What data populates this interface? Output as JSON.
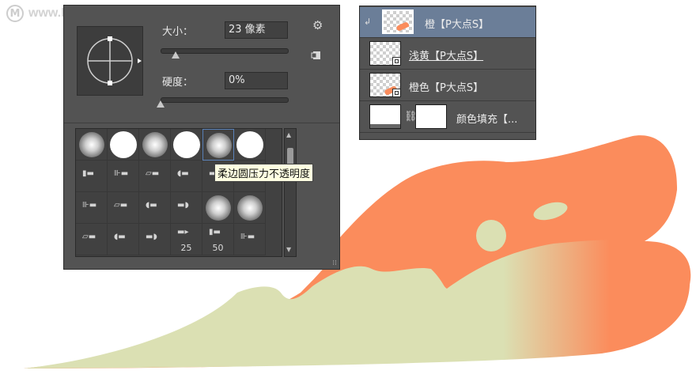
{
  "watermark": {
    "logo_letter": "M",
    "text": "www.MacDown.com"
  },
  "brush_panel": {
    "size_label": "大小：",
    "size_value": "23 像素",
    "size_level": 0.12,
    "hardness_label": "硬度：",
    "hardness_value": "0%",
    "hardness_level": 0.0,
    "settings_icon": "gear-icon",
    "new_preset_icon": "new-preset-icon",
    "preset_grid": [
      [
        {
          "kind": "soft"
        },
        {
          "kind": "hard"
        },
        {
          "kind": "soft"
        },
        {
          "kind": "hard"
        },
        {
          "kind": "soft",
          "selected": true
        },
        {
          "kind": "hard"
        }
      ],
      [
        {
          "kind": "tip"
        },
        {
          "kind": "tip"
        },
        {
          "kind": "tip"
        },
        {
          "kind": "tip"
        },
        {
          "kind": "tip"
        },
        {
          "kind": "tip"
        }
      ],
      [
        {
          "kind": "tip"
        },
        {
          "kind": "tip"
        },
        {
          "kind": "tip"
        },
        {
          "kind": "tip"
        },
        {
          "kind": "soft"
        },
        {
          "kind": "soft"
        }
      ],
      [
        {
          "kind": "tip"
        },
        {
          "kind": "tip"
        },
        {
          "kind": "tip"
        },
        {
          "kind": "tip",
          "number": "25"
        },
        {
          "kind": "tip",
          "number": "50"
        },
        {
          "kind": "tip"
        }
      ]
    ],
    "tooltip": "柔边圆压力不透明度"
  },
  "layers": [
    {
      "name": "橙【P大点S】",
      "selected": true,
      "clipped": true,
      "thumb": "checker-orange"
    },
    {
      "name": "浅黄【P大点S】",
      "selected": false,
      "underlined": true,
      "thumb": "checker-mask"
    },
    {
      "name": "橙色【P大点S】",
      "selected": false,
      "thumb": "checker-orange-mask"
    },
    {
      "name": "颜色填充【...",
      "selected": false,
      "thumb": "fill"
    }
  ],
  "colors": {
    "orange": "#fb8c5c",
    "pale_yellow": "#dbe0b3",
    "panel_bg": "#535353",
    "selected_layer": "#6b7e98",
    "tooltip_bg": "#ffffe1"
  }
}
